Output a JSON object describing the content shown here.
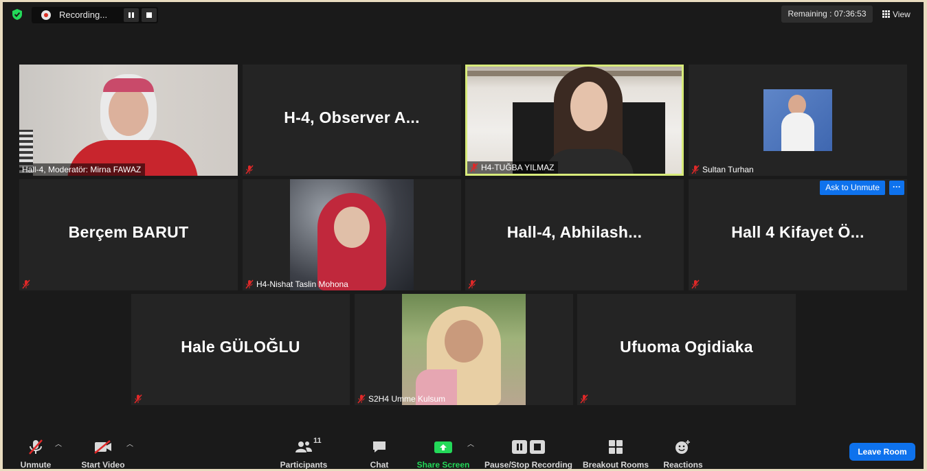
{
  "recording": {
    "label": "Recording..."
  },
  "timer": {
    "label": "Remaining : 07:36:53"
  },
  "view": {
    "label": "View"
  },
  "tiles": [
    {
      "name": "Hall-4, Moderatör: Mirna FAWAZ"
    },
    {
      "name": "",
      "display": "H-4,  Observer A..."
    },
    {
      "name": "H4-TUĞBA YILMAZ"
    },
    {
      "name": "Sultan Turhan"
    },
    {
      "name": "",
      "display": "Berçem BARUT"
    },
    {
      "name": "H4-Nishat Taslin Mohona"
    },
    {
      "name": "",
      "display": "Hall-4,  Abhilash..."
    },
    {
      "name": "",
      "display": "Hall 4 Kifayet Ö..."
    },
    {
      "name": "",
      "display": "Hale GÜLOĞLU"
    },
    {
      "name": "S2H4 Umme Kulsum"
    },
    {
      "name": "",
      "display": "Ufuoma Ogidiaka"
    }
  ],
  "ask_to_unmute": "Ask to Unmute",
  "more": "···",
  "toolbar": {
    "unmute": "Unmute",
    "start_video": "Start Video",
    "participants": "Participants",
    "participants_count": "11",
    "chat": "Chat",
    "share_screen": "Share Screen",
    "pause_stop_recording": "Pause/Stop Recording",
    "breakout_rooms": "Breakout Rooms",
    "reactions": "Reactions",
    "leave_room": "Leave Room"
  },
  "colors": {
    "active_speaker_border": "#d8eb7a",
    "accent_blue": "#0e72ed",
    "share_green": "#23d959",
    "muted_red": "#e02828"
  }
}
